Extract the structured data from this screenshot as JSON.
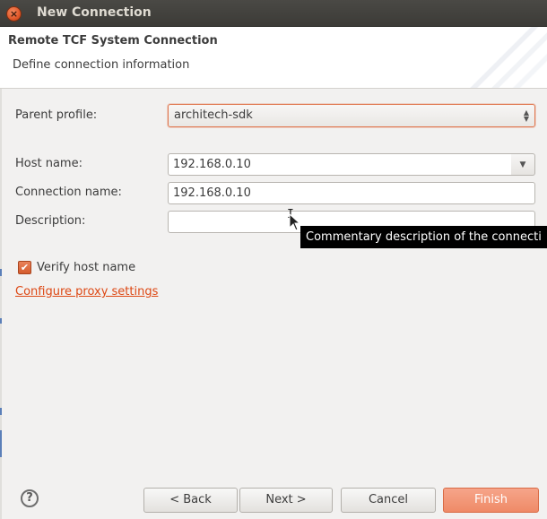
{
  "window": {
    "title": "New Connection",
    "close_glyph": "×"
  },
  "banner": {
    "title": "Remote TCF System Connection",
    "description": "Define connection information"
  },
  "form": {
    "parent_profile_label": "Parent profile:",
    "parent_profile_value": "architech-sdk",
    "host_name_label": "Host name:",
    "host_name_value": "192.168.0.10",
    "connection_name_label": "Connection name:",
    "connection_name_value": "192.168.0.10",
    "description_label": "Description:",
    "description_value": "",
    "verify_host_label": "Verify host name",
    "verify_host_checked": true,
    "proxy_link": "Configure proxy settings"
  },
  "tooltip": {
    "text": "Commentary description of the connecti"
  },
  "buttons": {
    "back": "< Back",
    "next": "Next >",
    "cancel": "Cancel",
    "finish": "Finish"
  },
  "help": {
    "glyph": "?"
  },
  "colors": {
    "accent": "#dd4814",
    "titlebar": "#3c3b37",
    "tooltip_bg": "#000000"
  },
  "icons": [
    "close-icon",
    "updown-arrows-icon",
    "chevron-down-icon",
    "ibeam-cursor-icon",
    "arrow-cursor-icon",
    "checkmark-icon",
    "help-icon"
  ]
}
